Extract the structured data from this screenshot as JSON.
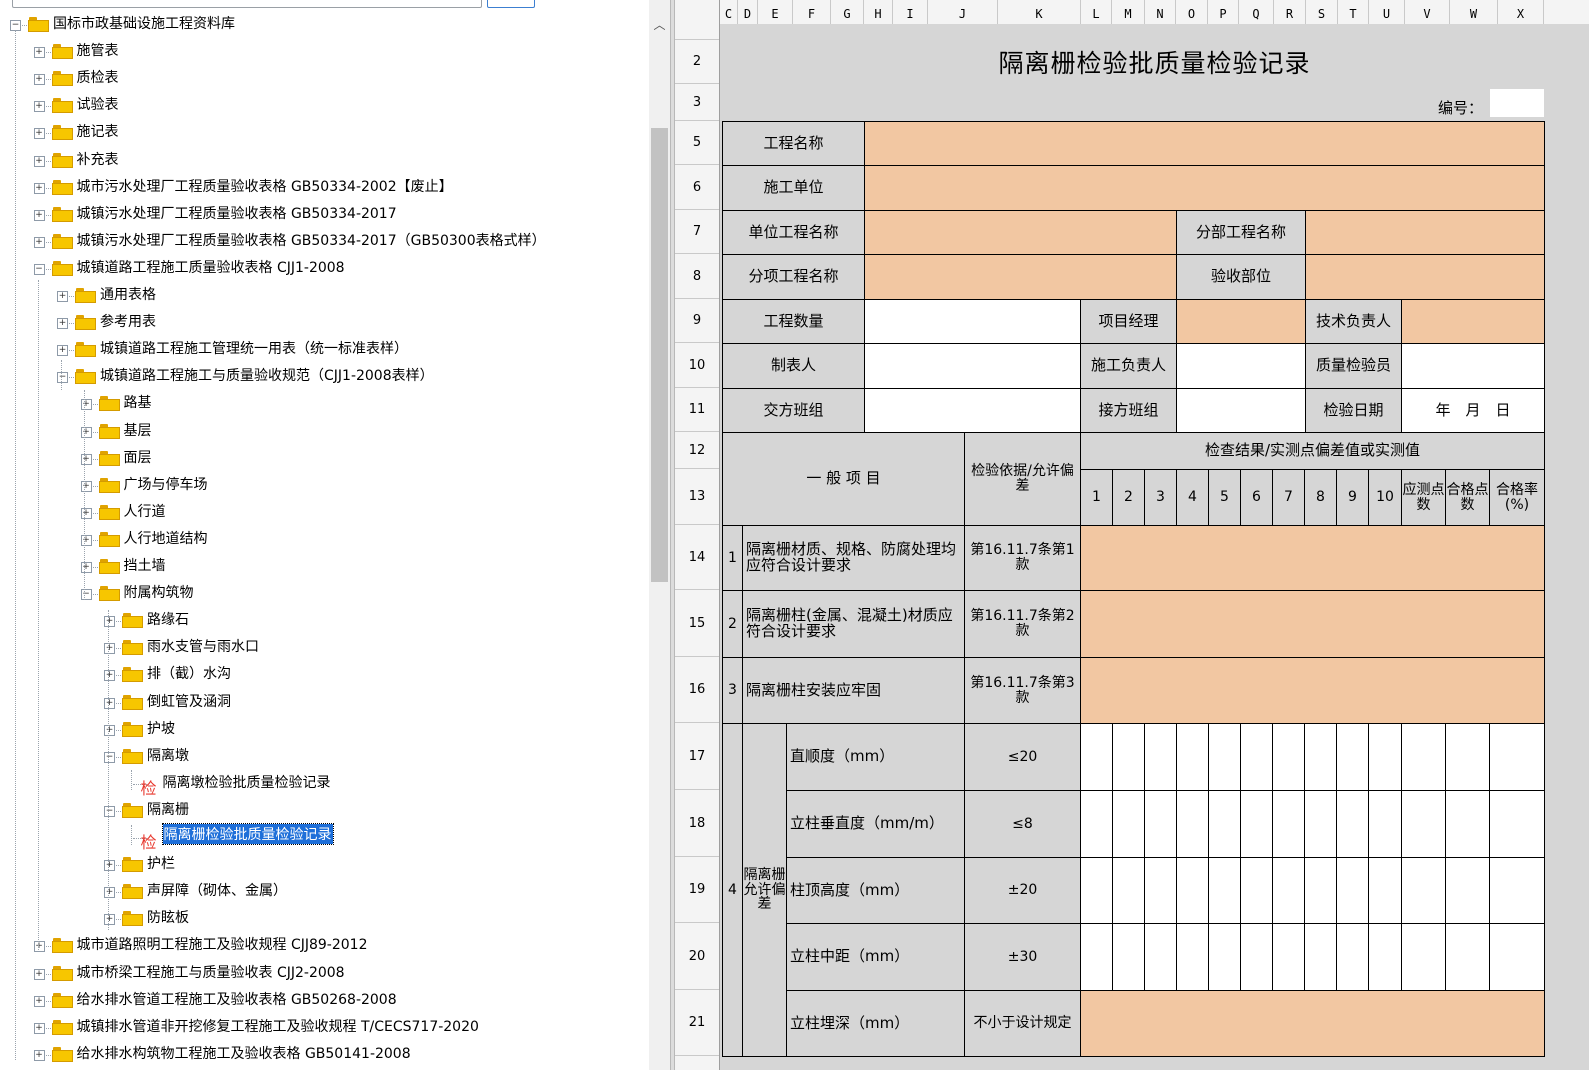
{
  "tree": {
    "root_label": "国标市政基础设施工程资料库",
    "top_items": [
      "施管表",
      "质检表",
      "试验表",
      "施记表",
      "补充表",
      "城市污水处理厂工程质量验收表格 GB50334-2002【废止】",
      "城镇污水处理厂工程质量验收表格 GB50334-2017",
      "城镇污水处理厂工程质量验收表格 GB50334-2017（GB50300表格式样）",
      "城镇道路工程施工质量验收表格 CJJ1-2008"
    ],
    "road_children": [
      "通用表格",
      "参考用表",
      "城镇道路工程施工管理统一用表（统一标准表样）",
      "城镇道路工程施工与质量验收规范（CJJ1-2008表样）"
    ],
    "spec_children": [
      "路基",
      "基层",
      "面层",
      "广场与停车场",
      "人行道",
      "人行地道结构",
      "挡土墙",
      "附属构筑物"
    ],
    "attach_children": [
      "路缘石",
      "雨水支管与雨水口",
      "排（截）水沟",
      "倒虹管及涵洞",
      "护坡",
      "隔离墩"
    ],
    "pier_doc": "隔离墩检验批质量检验记录",
    "fence_label": "隔离栅",
    "fence_doc": "隔离栅检验批质量检验记录",
    "after_fence": [
      "护栏",
      "声屏障（砌体、金属）",
      "防眩板"
    ],
    "bottom_items": [
      "城市道路照明工程施工及验收规程 CJJ89-2012",
      "城市桥梁工程施工与质量验收表 CJJ2-2008",
      "给水排水管道工程施工及验收表格 GB50268-2008",
      "城镇排水管道非开挖修复工程施工及验收规程 T/CECS717-2020",
      "给水排水构筑物工程施工及验收表格 GB50141-2008"
    ],
    "doc_badge": "检"
  },
  "sheet": {
    "columns": [
      "C",
      "D",
      "E",
      "F",
      "G",
      "H",
      "I",
      "J",
      "K",
      "L",
      "M",
      "N",
      "O",
      "P",
      "Q",
      "R",
      "S",
      "T",
      "U",
      "V",
      "W",
      "X"
    ],
    "rows": [
      "2",
      "3",
      "5",
      "6",
      "7",
      "8",
      "9",
      "10",
      "11",
      "12",
      "13",
      "14",
      "15",
      "16",
      "17",
      "18",
      "19",
      "20",
      "21"
    ],
    "title": "隔离栅检验批质量检验记录",
    "serial_label": "编号：",
    "project_name": "工程名称",
    "contractor": "施工单位",
    "unit_project": "单位工程名称",
    "sub_project": "分部工程名称",
    "item_project": "分项工程名称",
    "accept_part": "验收部位",
    "quantity": "工程数量",
    "project_manager": "项目经理",
    "tech_lead": "技术负责人",
    "tabulator": "制表人",
    "construction_lead": "施工负责人",
    "quality_inspector": "质量检验员",
    "handover_team": "交方班组",
    "receive_team": "接方班组",
    "inspect_date": "检验日期",
    "date_format": "年　月　日",
    "general_items": "一 般 项 目",
    "basis": "检验依据/允许偏差",
    "result_header": "检查结果/实测点偏差值或实测值",
    "points": [
      "1",
      "2",
      "3",
      "4",
      "5",
      "6",
      "7",
      "8",
      "9",
      "10"
    ],
    "should_points": "应测点数",
    "pass_points": "合格点数",
    "pass_rate": "合格率(%)",
    "items": [
      {
        "no": "1",
        "text": "隔离栅材质、规格、防腐处理均应符合设计要求",
        "basis": "第16.11.7条第1款"
      },
      {
        "no": "2",
        "text": "隔离栅柱(金属、混凝土)材质应符合设计要求",
        "basis": "第16.11.7条第2款"
      },
      {
        "no": "3",
        "text": "隔离栅柱安装应牢固",
        "basis": "第16.11.7条第3款"
      }
    ],
    "item4_no": "4",
    "item4_group": "隔离栅允许偏差",
    "tolerances": [
      {
        "name": "直顺度（mm）",
        "limit": "≤20"
      },
      {
        "name": "立柱垂直度（mm/m）",
        "limit": "≤8"
      },
      {
        "name": "柱顶高度（mm）",
        "limit": "±20"
      },
      {
        "name": "立柱中距（mm）",
        "limit": "±30"
      },
      {
        "name": "立柱埋深（mm）",
        "limit": "不小于设计规定"
      }
    ]
  },
  "colors": {
    "input_fill": "#f2c7a2",
    "form_bg": "#d6d6d6",
    "selection": "#1e6fd9"
  }
}
